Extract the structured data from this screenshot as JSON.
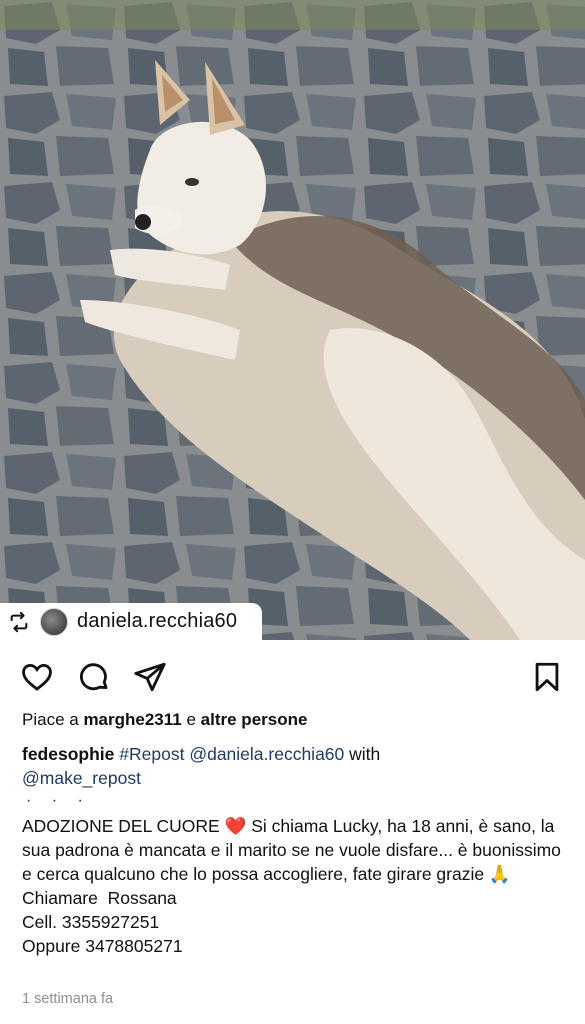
{
  "repost": {
    "username": "daniela.recchia60"
  },
  "likes": {
    "prefix": "Piace a",
    "user": "marghe2311",
    "middle": "e",
    "others": "altre persone"
  },
  "caption": {
    "author": "fedesophie",
    "repost_tag": "#Repost",
    "repost_mention": "@daniela.recchia60",
    "with_word": "with",
    "make_repost": "@make_repost",
    "dots": "· · ·",
    "text_1": "ADOZIONE DEL CUORE ❤️ Si chiama Lucky, ha 18 anni, è sano, la sua padrona è mancata e il marito se ne vuole disfare... è buonissimo e cerca qualcuno che lo possa accogliere, fate girare grazie 🙏",
    "text_2": "Chiamare  Rossana",
    "text_3": "Cell. 3355927251",
    "text_4": "Oppure 3478805271"
  },
  "timestamp": "1 settimana fa",
  "icons": {
    "like": "heart-icon",
    "comment": "comment-icon",
    "share": "send-icon",
    "save": "bookmark-icon",
    "repost": "repost-icon"
  },
  "colors": {
    "link": "#1f3b63",
    "muted": "#8e8e8e"
  }
}
